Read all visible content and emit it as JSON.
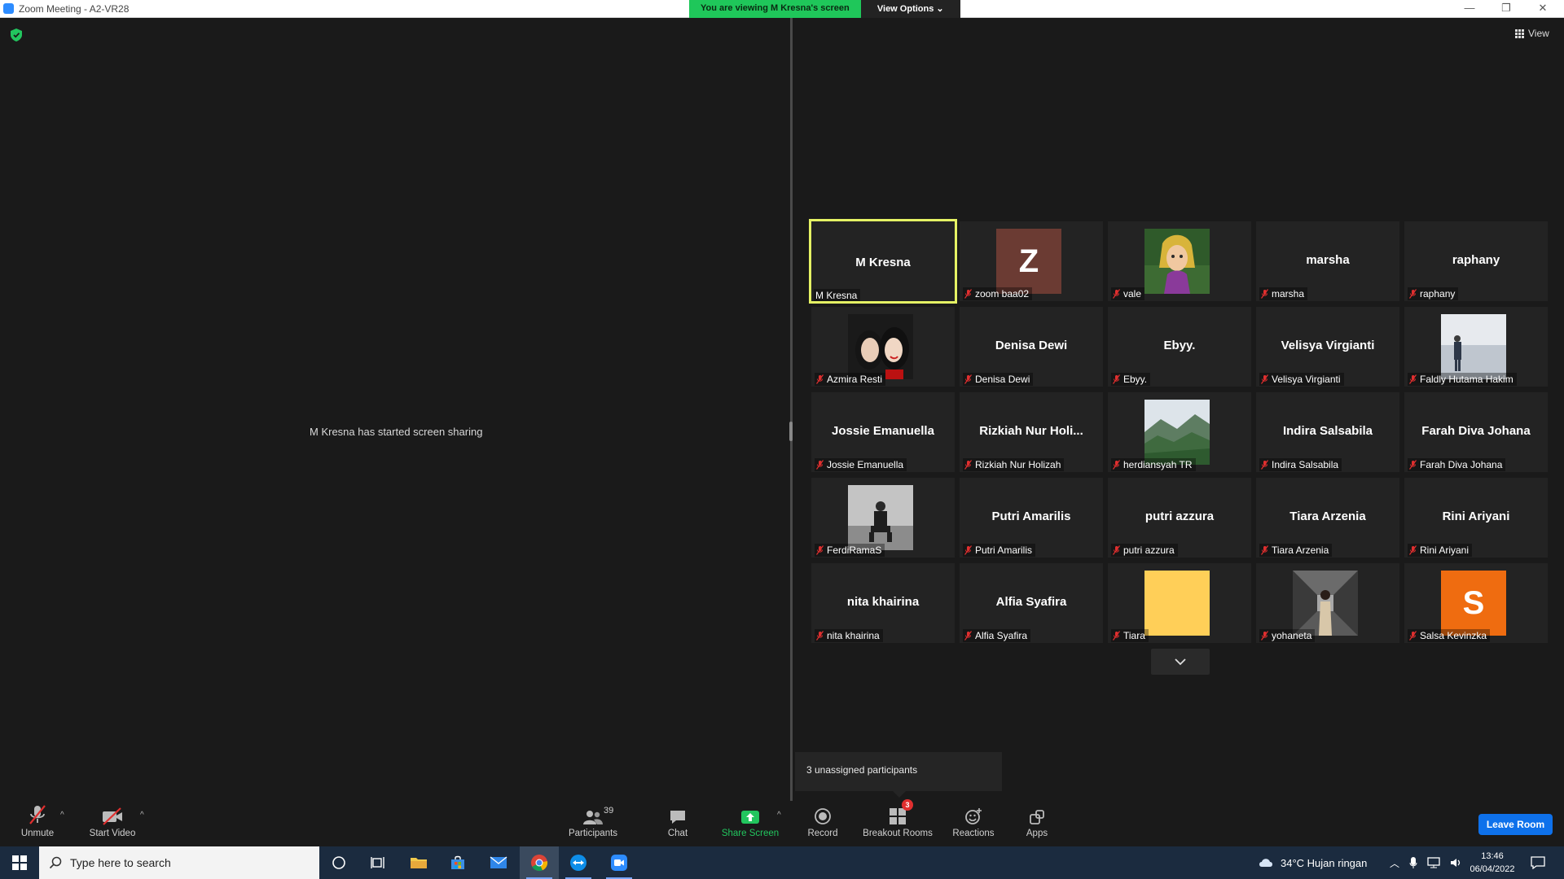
{
  "window": {
    "title": "Zoom Meeting - A2-VR28",
    "viewing_banner": "You are viewing M Kresna's screen",
    "view_options": "View Options"
  },
  "view_button": "View",
  "share_message": "M Kresna has started screen sharing",
  "participants": [
    {
      "big": "M Kresna",
      "label": "M Kresna",
      "type": "name",
      "active": true,
      "muted": false
    },
    {
      "big": "Z",
      "label": "zoom baa02",
      "type": "letter",
      "color": "#6b3b33",
      "muted": true
    },
    {
      "big": "",
      "label": "vale",
      "type": "avatar",
      "variant": "cartoon",
      "muted": true
    },
    {
      "big": "marsha",
      "label": "marsha",
      "type": "name",
      "muted": true
    },
    {
      "big": "raphany",
      "label": "raphany",
      "type": "name",
      "muted": true
    },
    {
      "big": "",
      "label": "Azmira Resti",
      "type": "avatar",
      "variant": "duo",
      "muted": true
    },
    {
      "big": "Denisa Dewi",
      "label": "Denisa Dewi",
      "type": "name",
      "muted": true
    },
    {
      "big": "Ebyy.",
      "label": "Ebyy.",
      "type": "name",
      "muted": true
    },
    {
      "big": "Velisya Virgianti",
      "label": "Velisya Virgianti",
      "type": "name",
      "muted": true
    },
    {
      "big": "",
      "label": "Faldly Hutama Hakim",
      "type": "avatar",
      "variant": "room",
      "muted": true
    },
    {
      "big": "Jossie Emanuella",
      "label": "Jossie Emanuella",
      "type": "name",
      "muted": true
    },
    {
      "big": "Rizkiah  Nur  Holi...",
      "label": "Rizkiah Nur Holizah",
      "type": "name",
      "muted": true
    },
    {
      "big": "",
      "label": "herdiansyah TR",
      "type": "avatar",
      "variant": "mountain",
      "muted": true
    },
    {
      "big": "Indira Salsabila",
      "label": "Indira Salsabila",
      "type": "name",
      "muted": true
    },
    {
      "big": "Farah Diva Johana",
      "label": "Farah Diva Johana",
      "type": "name",
      "muted": true
    },
    {
      "big": "",
      "label": "FerdiRamaS",
      "type": "avatar",
      "variant": "street",
      "muted": true
    },
    {
      "big": "Putri Amarilis",
      "label": "Putri Amarilis",
      "type": "name",
      "muted": true
    },
    {
      "big": "putri azzura",
      "label": "putri azzura",
      "type": "name",
      "muted": true
    },
    {
      "big": "Tiara Arzenia",
      "label": "Tiara Arzenia",
      "type": "name",
      "muted": true
    },
    {
      "big": "Rini Ariyani",
      "label": "Rini Ariyani",
      "type": "name",
      "muted": true
    },
    {
      "big": "nita khairina",
      "label": "nita khairina",
      "type": "name",
      "muted": true
    },
    {
      "big": "Alfia Syafira",
      "label": "Alfia Syafira",
      "type": "name",
      "muted": true
    },
    {
      "big": "",
      "label": "Tiara",
      "type": "avatar",
      "variant": "yellow",
      "muted": true
    },
    {
      "big": "",
      "label": "yohaneta",
      "type": "avatar",
      "variant": "corridor",
      "muted": true
    },
    {
      "big": "S",
      "label": "Salsa Kevinzka",
      "type": "letter",
      "color": "#ef6c10",
      "muted": true
    }
  ],
  "unassigned": "3 unassigned participants",
  "toolbar": {
    "unmute": "Unmute",
    "start_video": "Start Video",
    "participants": "Participants",
    "participants_count": "39",
    "chat": "Chat",
    "share_screen": "Share Screen",
    "record": "Record",
    "breakout_rooms": "Breakout Rooms",
    "breakout_badge": "3",
    "reactions": "Reactions",
    "apps": "Apps",
    "leave_room": "Leave Room"
  },
  "taskbar": {
    "search_placeholder": "Type here to search",
    "weather": "34°C  Hujan ringan",
    "time": "13:46",
    "date": "06/04/2022"
  },
  "colors": {
    "active_speaker_border": "#e5f264",
    "share_green": "#22c55e",
    "leave_blue": "#0e71eb",
    "muted_red": "#e02f2f"
  }
}
